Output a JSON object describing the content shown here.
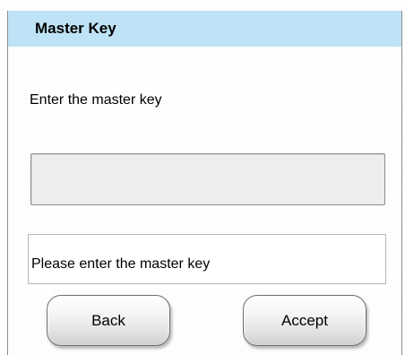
{
  "window": {
    "title": "Master Key"
  },
  "prompt": {
    "label": "Enter the master key"
  },
  "master_key_field": {
    "value": "",
    "placeholder": ""
  },
  "status": {
    "message": "Please enter the master key"
  },
  "buttons": {
    "back_label": "Back",
    "accept_label": "Accept"
  },
  "colors": {
    "title_bar": "#bfe3f6",
    "input_background": "#efeeec",
    "window_background": "#ffffff"
  }
}
